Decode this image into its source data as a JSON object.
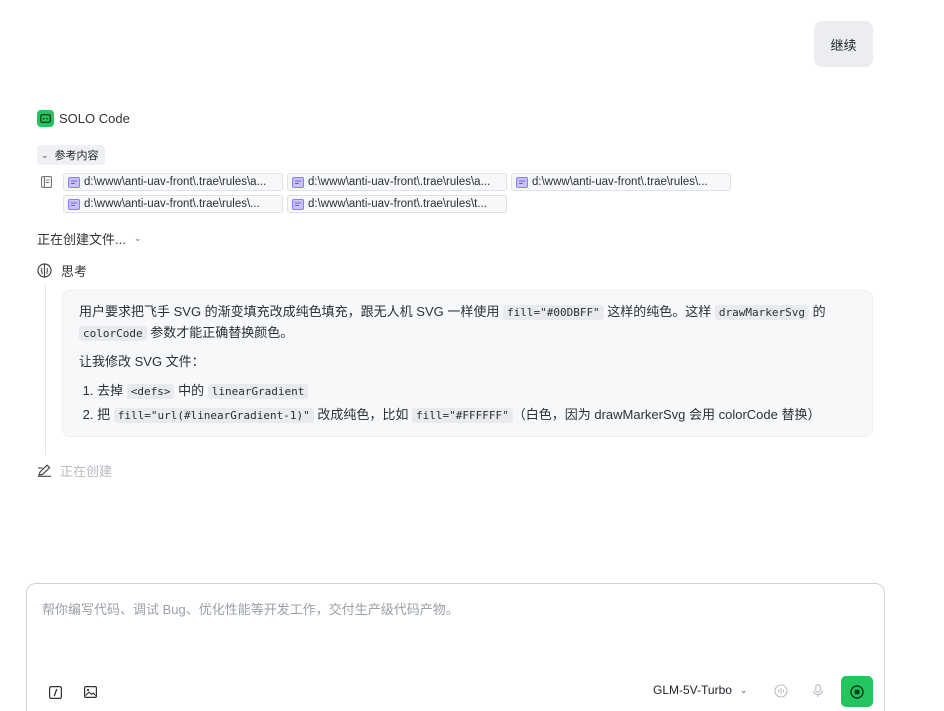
{
  "user_message": "继续",
  "agent": {
    "name": "SOLO Code"
  },
  "references": {
    "toggle_label": "参考内容",
    "files": [
      "d:\\www\\anti-uav-front\\.trae\\rules\\a...",
      "d:\\www\\anti-uav-front\\.trae\\rules\\a...",
      "d:\\www\\anti-uav-front\\.trae\\rules\\...",
      "d:\\www\\anti-uav-front\\.trae\\rules\\...",
      "d:\\www\\anti-uav-front\\.trae\\rules\\t..."
    ]
  },
  "status": {
    "label": "正在创建文件..."
  },
  "thinking": {
    "label": "思考",
    "p1": {
      "a": "用户要求把飞手 SVG 的渐变填充改成纯色填充，跟无人机 SVG 一样使用 ",
      "code1": "fill=\"#00DBFF\"",
      "b": " 这样的纯色。这样 ",
      "code2": "drawMarkerSvg",
      "c": " 的",
      "code3": "colorCode",
      "d": " 参数才能正确替换颜色。"
    },
    "p2": "让我修改 SVG 文件：",
    "steps": [
      {
        "num": "1.",
        "a": "去掉 ",
        "code1": "<defs>",
        "b": " 中的 ",
        "code2": "linearGradient",
        "c": ""
      },
      {
        "num": "2.",
        "a": "把 ",
        "code1": "fill=\"url(#linearGradient-1)\"",
        "b": " 改成纯色，比如 ",
        "code2": "fill=\"#FFFFFF\"",
        "c": "（白色，因为 drawMarkerSvg 会用 colorCode 替换）"
      }
    ]
  },
  "creating": {
    "label": "正在创建"
  },
  "composer": {
    "placeholder": "帮你编写代码、调试 Bug、优化性能等开发工作，交付生产级代码产物。",
    "model": "GLM-5V-Turbo"
  },
  "colors": {
    "accent": "#22c55e",
    "chip_icon": "#8b7cf6"
  }
}
